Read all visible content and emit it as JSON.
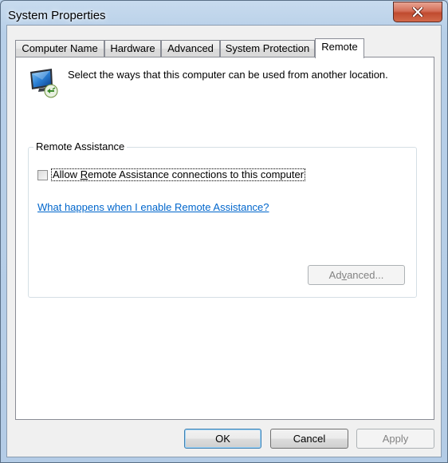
{
  "window": {
    "title": "System Properties",
    "close_icon": "close-icon"
  },
  "tabs": [
    {
      "label": "Computer Name",
      "active": false
    },
    {
      "label": "Hardware",
      "active": false
    },
    {
      "label": "Advanced",
      "active": false
    },
    {
      "label": "System Protection",
      "active": false
    },
    {
      "label": "Remote",
      "active": true
    }
  ],
  "remote": {
    "icon": "remote-computer-icon",
    "intro": "Select the ways that this computer can be used from another location.",
    "assistance": {
      "group_label": "Remote Assistance",
      "checkbox_label_pre": "Allow ",
      "checkbox_label_key": "R",
      "checkbox_label_post": "emote Assistance connections to this computer",
      "checked": false,
      "help_link": "What happens when I enable Remote Assistance?",
      "advanced_pre": "Ad",
      "advanced_key": "v",
      "advanced_post": "anced...",
      "advanced_enabled": false
    }
  },
  "footer": {
    "ok": "OK",
    "cancel": "Cancel",
    "apply": "Apply"
  }
}
